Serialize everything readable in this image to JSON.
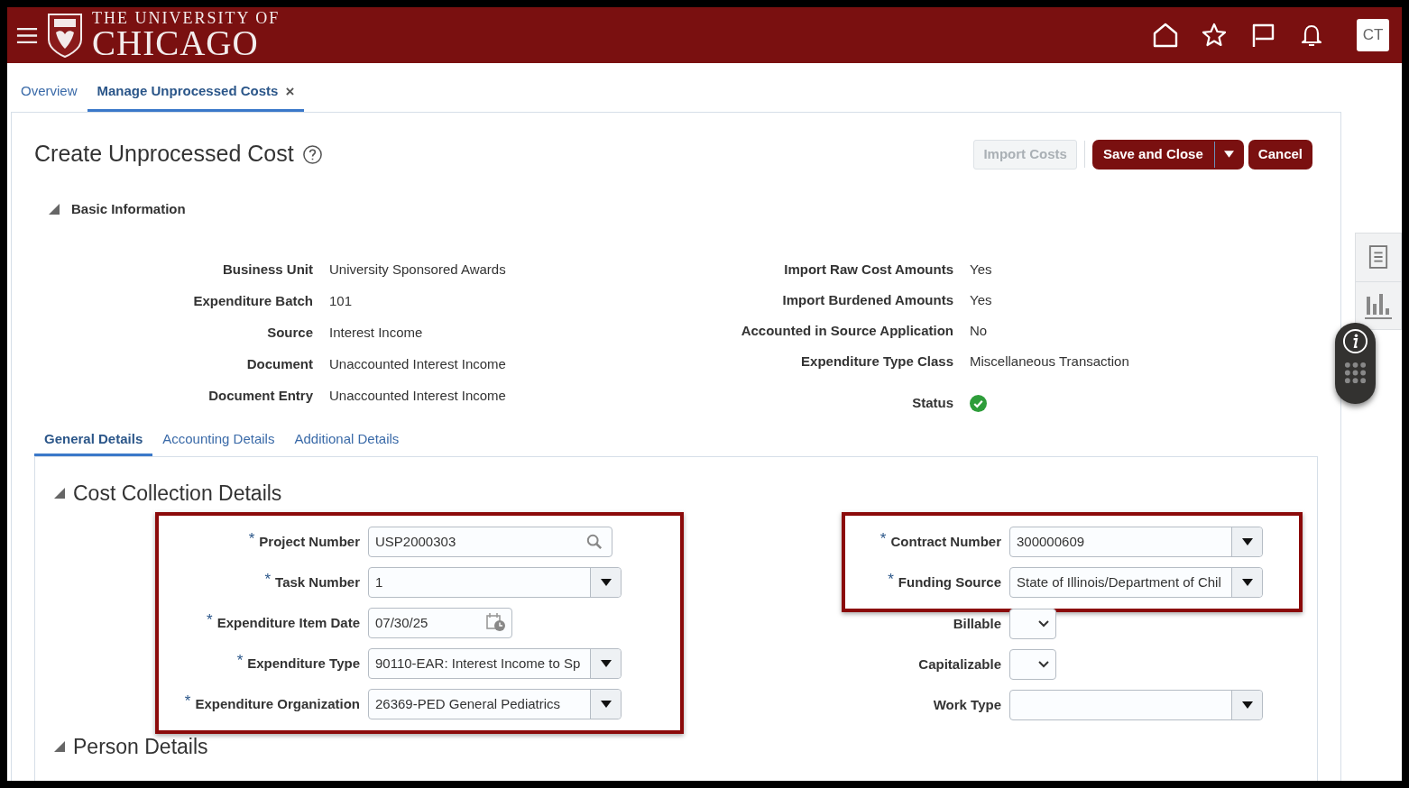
{
  "header": {
    "logo_line1": "THE UNIVERSITY OF",
    "logo_line2": "CHICAGO",
    "user_initials": "CT"
  },
  "page_tabs": [
    {
      "label": "Overview",
      "selected": false
    },
    {
      "label": "Manage Unprocessed Costs",
      "selected": true,
      "close": "×"
    }
  ],
  "title": "Create Unprocessed Cost",
  "buttons": [
    {
      "label": "Import Costs",
      "kind": "secondary",
      "disabled": true
    },
    {
      "label": "Save and Close",
      "kind": "split",
      "disabled": false
    },
    {
      "label": "Cancel",
      "kind": "primary",
      "disabled": false
    }
  ],
  "basic_info": {
    "heading": "Basic Information",
    "expanded": true,
    "left": [
      {
        "label": "Business Unit",
        "value": "University Sponsored Awards"
      },
      {
        "label": "Expenditure Batch",
        "value": "101"
      },
      {
        "label": "Source",
        "value": "Interest Income"
      },
      {
        "label": "Document",
        "value": "Unaccounted Interest Income"
      },
      {
        "label": "Document Entry",
        "value": "Unaccounted Interest Income"
      }
    ],
    "right": [
      {
        "label": "Import Raw Cost Amounts",
        "kind": "text",
        "value": "Yes"
      },
      {
        "label": "Import Burdened Amounts",
        "kind": "text",
        "value": "Yes"
      },
      {
        "label": "Accounted in Source Application",
        "kind": "text",
        "value": "No"
      },
      {
        "label": "Expenditure Type Class",
        "kind": "text",
        "value": "Miscellaneous Transaction"
      },
      {
        "label": "Status",
        "kind": "status",
        "ok": true
      }
    ]
  },
  "detail_tabs": [
    {
      "label": "General Details",
      "selected": true
    },
    {
      "label": "Accounting Details",
      "selected": false
    },
    {
      "label": "Additional Details",
      "selected": false
    }
  ],
  "cost_collection": {
    "heading": "Cost Collection Details",
    "expanded": true,
    "left_groups": [
      {
        "highlighted": true,
        "fields": [
          {
            "label": "Project Number",
            "required": "*",
            "kind": "search",
            "value": "USP2000303"
          },
          {
            "label": "Task Number",
            "required": "*",
            "kind": "select",
            "value": "1"
          },
          {
            "label": "Expenditure Item Date",
            "required": "*",
            "kind": "date",
            "value": "07/30/25"
          },
          {
            "label": "Expenditure Type",
            "required": "*",
            "kind": "select",
            "value": "90110-EAR: Interest Income to Sp"
          },
          {
            "label": "Expenditure Organization",
            "required": "*",
            "kind": "select",
            "value": "26369-PED General Pediatrics"
          }
        ]
      }
    ],
    "right_groups": [
      {
        "highlighted": true,
        "fields": [
          {
            "label": "Contract Number",
            "required": "*",
            "kind": "select",
            "value": "300000609"
          },
          {
            "label": "Funding Source",
            "required": "*",
            "kind": "select",
            "value": "State of Illinois/Department of Chil"
          }
        ]
      },
      {
        "highlighted": false,
        "fields": [
          {
            "label": "Billable",
            "kind": "choice"
          },
          {
            "label": "Capitalizable",
            "kind": "choice"
          },
          {
            "label": "Work Type",
            "kind": "select"
          }
        ]
      }
    ]
  },
  "person_details": {
    "heading": "Person Details",
    "expanded": true
  }
}
